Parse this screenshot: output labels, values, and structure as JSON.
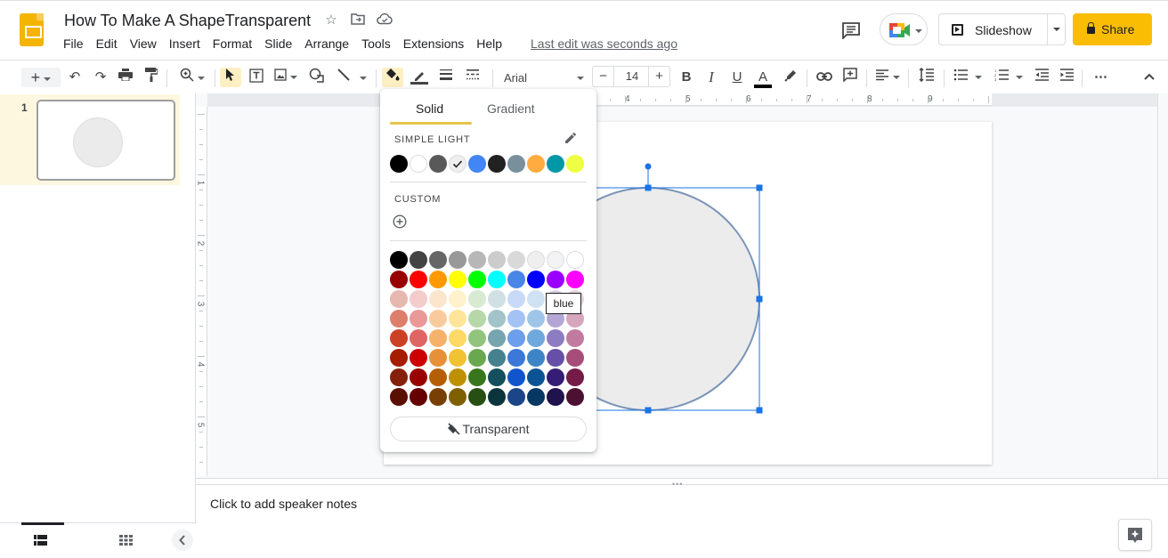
{
  "app": {
    "title": "How To Make A ShapeTransparent",
    "last_edit": "Last edit was seconds ago"
  },
  "menu": [
    "File",
    "Edit",
    "View",
    "Insert",
    "Format",
    "Slide",
    "Arrange",
    "Tools",
    "Extensions",
    "Help"
  ],
  "header_buttons": {
    "slideshow": "Slideshow",
    "share": "Share"
  },
  "toolbar": {
    "font_name": "Arial",
    "font_size": "14",
    "minus": "−",
    "plus": "+",
    "bold": "B",
    "italic": "I",
    "underline": "U",
    "text_color": "A",
    "more": "⋯"
  },
  "filmstrip": {
    "slide_number": "1"
  },
  "ruler": {
    "horizontal": [
      "4",
      "5",
      "6",
      "7",
      "8",
      "9"
    ],
    "vertical": [
      "1",
      "2",
      "3",
      "4",
      "5"
    ]
  },
  "fill_popup": {
    "tabs": [
      {
        "label": "Solid",
        "active": true
      },
      {
        "label": "Gradient",
        "active": false
      }
    ],
    "theme_label": "SIMPLE LIGHT",
    "custom_label": "CUSTOM",
    "transparent_label": "Transparent",
    "theme_colors": [
      "#000000",
      "#ffffff",
      "#595959",
      "#eeeeee",
      "#4285f4",
      "#212121",
      "#78909c",
      "#ffab40",
      "#0097a7",
      "#eeff41"
    ],
    "theme_selected_index": 3,
    "palette": [
      [
        "#000000",
        "#434343",
        "#666666",
        "#999999",
        "#b7b7b7",
        "#cccccc",
        "#d9d9d9",
        "#efefef",
        "#f3f3f3",
        "#ffffff"
      ],
      [
        "#980000",
        "#ff0000",
        "#ff9900",
        "#ffff00",
        "#00ff00",
        "#00ffff",
        "#4a86e8",
        "#0000ff",
        "#9900ff",
        "#ff00ff"
      ],
      [
        "#e6b8af",
        "#f4cccc",
        "#fce5cd",
        "#fff2cc",
        "#d9ead3",
        "#d0e0e3",
        "#c9daf8",
        "#cfe2f3",
        "#d9d2e9",
        "#ead1dc"
      ],
      [
        "#dd7e6b",
        "#ea9999",
        "#f9cb9c",
        "#ffe599",
        "#b6d7a8",
        "#a2c4c9",
        "#a4c2f4",
        "#9fc5e8",
        "#b4a7d6",
        "#d5a6bd"
      ],
      [
        "#cc4125",
        "#e06666",
        "#f6b26b",
        "#ffd966",
        "#93c47d",
        "#76a5af",
        "#6d9eeb",
        "#6fa8dc",
        "#8e7cc3",
        "#c27ba0"
      ],
      [
        "#a61c00",
        "#cc0000",
        "#e69138",
        "#f1c232",
        "#6aa84f",
        "#45818e",
        "#3c78d8",
        "#3d85c6",
        "#674ea7",
        "#a64d79"
      ],
      [
        "#85200c",
        "#990000",
        "#b45f06",
        "#bf9000",
        "#38761d",
        "#134f5c",
        "#1155cc",
        "#0b5394",
        "#351c75",
        "#741b47"
      ],
      [
        "#5b0f00",
        "#660000",
        "#783f04",
        "#7f6000",
        "#274e13",
        "#0c343d",
        "#1c4587",
        "#073763",
        "#20124d",
        "#4c1130"
      ]
    ],
    "tooltip": "blue"
  },
  "shape": {
    "fill": "#ececec",
    "outline": "#7a95b8",
    "selection": "#1a73e8"
  },
  "notes": {
    "placeholder": "Click to add speaker notes"
  },
  "colors": {
    "accent": "#fbbc04",
    "active_bg": "#feefc3"
  }
}
